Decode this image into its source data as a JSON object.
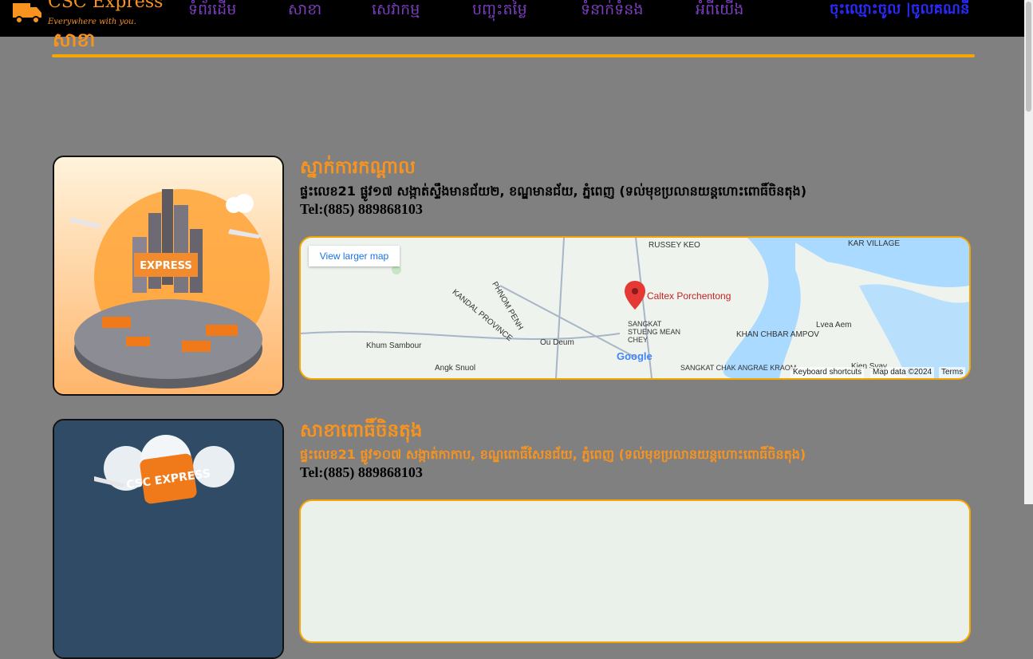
{
  "header": {
    "logo_name": "CSC Express",
    "logo_tagline": "Everywhere with you.",
    "nav": [
      {
        "label": "ទំព័រដើម"
      },
      {
        "label": "សាខា"
      },
      {
        "label": "សេវាកម្ម"
      },
      {
        "label": "បញ្ចុះតម្លៃ"
      },
      {
        "label": "ទំនាក់ទំនង"
      },
      {
        "label": "អំពីយើង"
      }
    ],
    "auth_label": "ចុះឈ្មោះចូល |ចូលគណនី"
  },
  "page": {
    "heading": "សាខា"
  },
  "branches": [
    {
      "title": "ស្នាក់ការកណ្ដាល",
      "address": "ផ្ទះលេខ21 ផ្លូវ១៧ សង្កាត់ស្ទឹងមានជ័យ២, ខណ្ឌមានជ័យ, ភ្នំពេញ (ទល់មុខប្រលានយន្តហោះពោធិ៍ចិនតុង)",
      "address_color": "#000000",
      "tel": "Tel:(885) 889868103",
      "image_badge": "EXPRESS",
      "map": {
        "view_larger": "View larger map",
        "pin_label": "Caltex Porchentong",
        "keyboard": "Keyboard shortcuts",
        "map_data": "Map data ©2024",
        "terms": "Terms",
        "google": "Google",
        "places": [
          "KANDAL PROVINCE",
          "PHNOM PENH",
          "Ou Deum",
          "Khum Sambour",
          "Angk Snuol",
          "SANGKAT STUENG MEAN CHEY",
          "KHAN CHBAR AMPOV",
          "Lvea Aem",
          "KAR VILLAGE",
          "RUSSEY KEO",
          "SANGKAT CHAK ANGRAE KRAOM",
          "Kien Svay"
        ]
      }
    },
    {
      "title": "សាខាពោធិ៍ចិនតុង",
      "address": "ផ្ទះលេខ21 ផ្លូវ១០៧ សង្កាត់កាកាប, ខណ្ឌពោធិ៍សែនជ័យ, ភ្នំពេញ (ទល់មុខប្រលានយន្តហោះពោធិ៍ចិនតុង)",
      "address_color": "#f7931e",
      "tel": "Tel:(885) 889868103",
      "image_badge": "CSC EXPRESS"
    }
  ],
  "colors": {
    "accent": "#f7931e",
    "nav": "#7b3fbf",
    "auth": "#2a2aff",
    "background": "#808080"
  }
}
